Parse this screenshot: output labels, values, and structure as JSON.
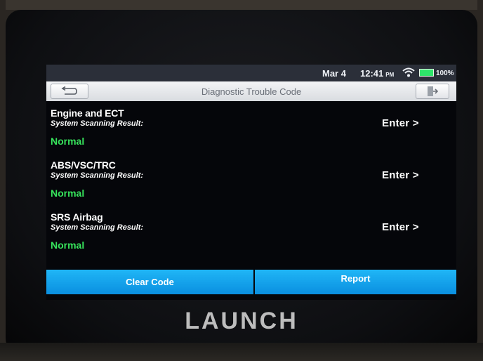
{
  "status_bar": {
    "date": "Mar 4",
    "time": "12:41",
    "ampm": "PM",
    "battery": "100%",
    "icons": [
      "wifi-icon",
      "battery-icon"
    ],
    "battery_color": "#2ee66a"
  },
  "header": {
    "title": "Diagnostic Trouble Code",
    "back_icon": "back-icon",
    "exit_icon": "exit-icon"
  },
  "results": [
    {
      "system": "Engine and ECT",
      "label": "System Scanning Result:",
      "status": "Normal",
      "action": "Enter >"
    },
    {
      "system": "ABS/VSC/TRC",
      "label": "System Scanning Result:",
      "status": "Normal",
      "action": "Enter >"
    },
    {
      "system": "SRS Airbag",
      "label": "System Scanning Result:",
      "status": "Normal",
      "action": "Enter >"
    }
  ],
  "footer": {
    "clear_code": "Clear Code",
    "report": "Report",
    "button_color": "#1aa6ee"
  },
  "brand": "LAUNCH",
  "colors": {
    "status_normal": "#37e45c",
    "screen_bg": "#05060a"
  }
}
